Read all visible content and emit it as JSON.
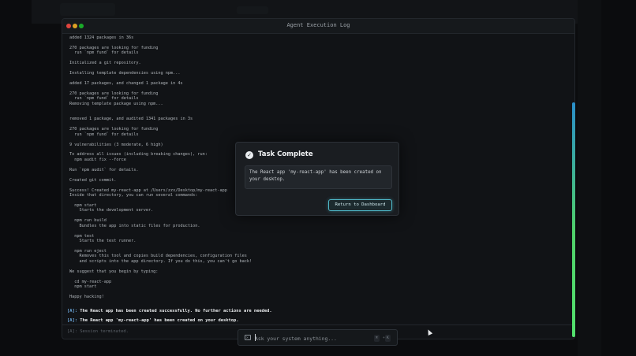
{
  "window": {
    "title": "Agent Execution Log"
  },
  "log": {
    "lines": [
      "added 1324 packages in 36s",
      "",
      "270 packages are looking for funding",
      "  run `npm fund` for details",
      "",
      "Initialized a git repository.",
      "",
      "Installing template dependencies using npm...",
      "",
      "added 17 packages, and changed 1 package in 4s",
      "",
      "270 packages are looking for funding",
      "  run `npm fund` for details",
      "Removing template package using npm...",
      "",
      "",
      "removed 1 package, and audited 1341 packages in 3s",
      "",
      "270 packages are looking for funding",
      "  run `npm fund` for details",
      "",
      "9 vulnerabilities (3 moderate, 6 high)",
      "",
      "To address all issues (including breaking changes), run:",
      "  npm audit fix --force",
      "",
      "Run `npm audit` for details.",
      "",
      "Created git commit.",
      "",
      "Success! Created my-react-app at /Users/zzx/Desktop/my-react-app",
      "Inside that directory, you can run several commands:",
      "",
      "  npm start",
      "    Starts the development server.",
      "",
      "  npm run build",
      "    Bundles the app into static files for production.",
      "",
      "  npm test",
      "    Starts the test runner.",
      "",
      "  npm run eject",
      "    Removes this tool and copies build dependencies, configuration files",
      "    and scripts into the app directory. If you do this, you can't go back!",
      "",
      "We suggest that you begin by typing:",
      "",
      "  cd my-react-app",
      "  npm start",
      "",
      "Happy hacking!"
    ]
  },
  "agent": {
    "tag": "[A]:",
    "messages": [
      "The React app has been created successfully. No further actions are needed.",
      "The React app 'my-react-app' has been created on your desktop."
    ],
    "terminated": "[A]: Session terminated."
  },
  "dialog": {
    "icon": "check-circle-icon",
    "title": "Task Complete",
    "message": "The React app 'my-react-app' has been created on your desktop.",
    "button_label": "Return to Dashboard"
  },
  "input": {
    "placeholder": "Ask your system anything...",
    "shortcut_key1": "⌘",
    "shortcut_sep": "+",
    "shortcut_key2": "K"
  },
  "colors": {
    "accent": "#4fb8c9",
    "scrollbar_top": "#2a8ec9",
    "scrollbar_bottom": "#53e06d"
  }
}
